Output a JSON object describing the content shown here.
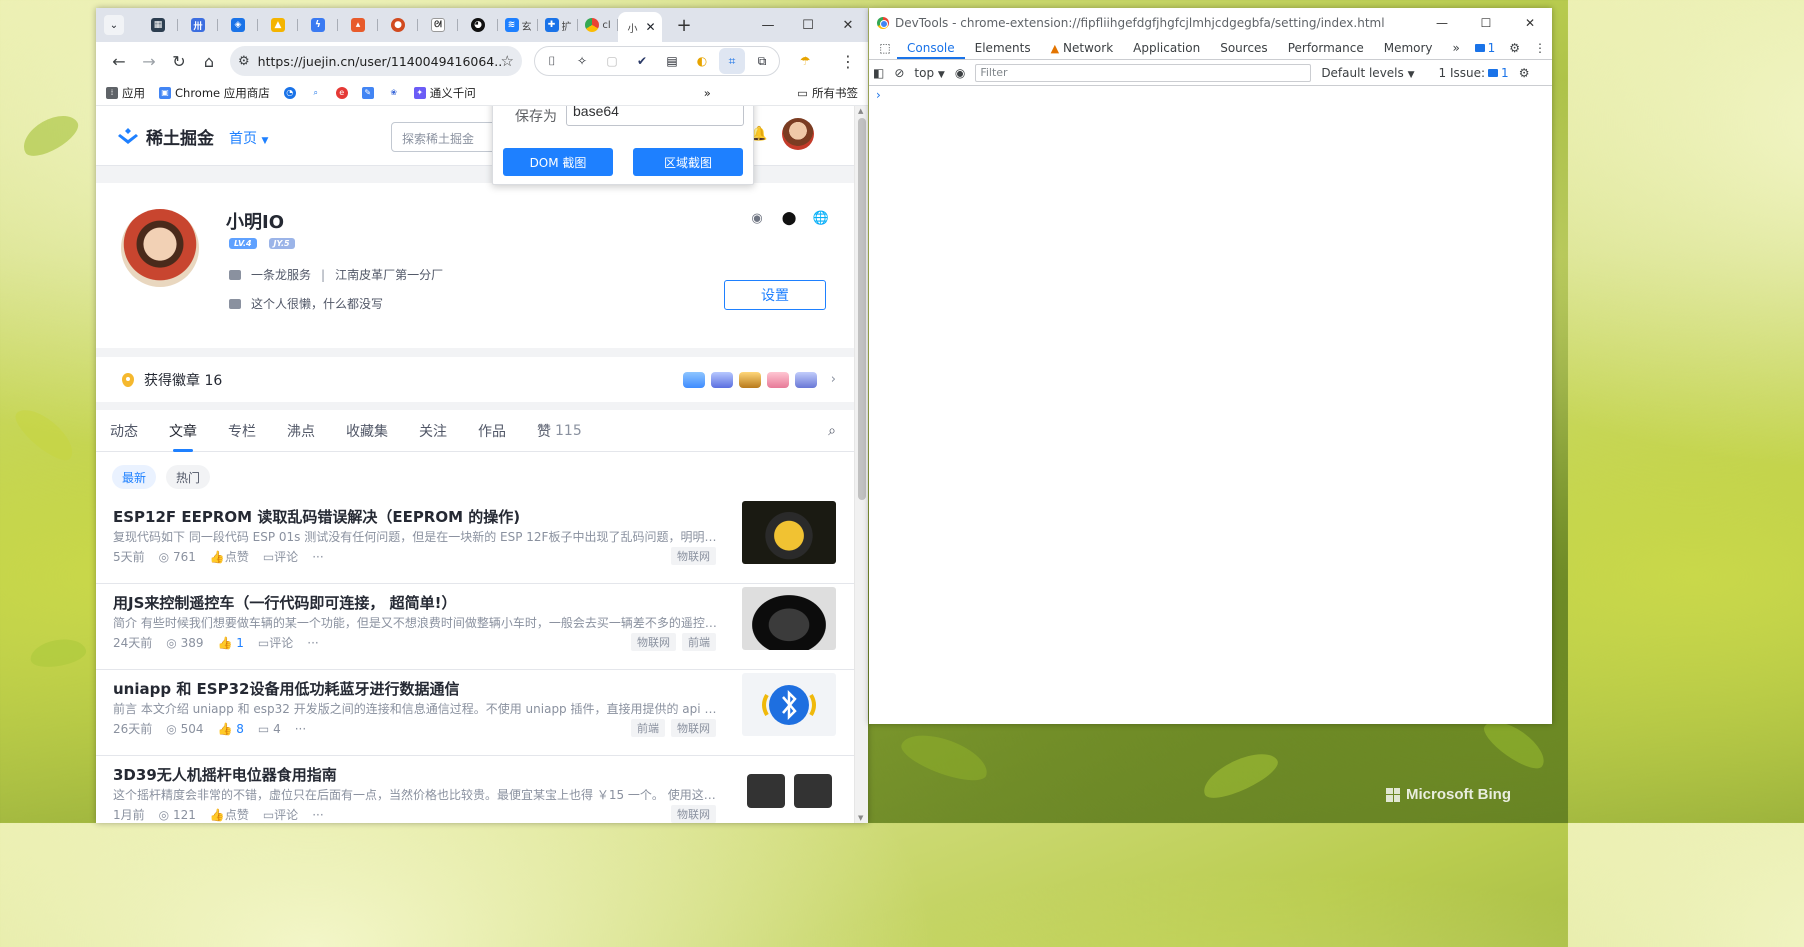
{
  "browser": {
    "tabs": [
      {
        "icon": "menu"
      },
      {
        "icon": "app-dark",
        "color": "#2c3e50"
      },
      {
        "icon": "grid-app",
        "color": "#3c6ee0"
      },
      {
        "icon": "shield-app",
        "color": "#1a73e8"
      },
      {
        "icon": "drive-app",
        "color": "#f4b400"
      },
      {
        "icon": "bolt-app",
        "color": "#3a7af2"
      },
      {
        "icon": "triangle-app",
        "color": "#e85b2b"
      },
      {
        "icon": "emblem-app",
        "color": "#d14a1f"
      },
      {
        "icon": "swirl-app",
        "color": "#333333"
      },
      {
        "icon": "github",
        "color": "#111111"
      },
      {
        "icon": "juejin",
        "color": "#1e80ff",
        "text": "玄"
      },
      {
        "icon": "puzzle",
        "color": "#1a73e8",
        "text": "扩"
      },
      {
        "icon": "chrome",
        "color": "#4285f4",
        "text": "cl"
      },
      {
        "icon": "juejin-active",
        "color": "#1e80ff",
        "text": "小"
      }
    ],
    "url": "https://juejin.cn/user/1140049416064...",
    "bookmarks": [
      {
        "label": "应用",
        "color": "#5f6368"
      },
      {
        "label": "Chrome 应用商店",
        "color": "#4285f4"
      },
      {
        "label": "",
        "color": "#1a73e8"
      },
      {
        "label": "",
        "color": "#1a73e8"
      },
      {
        "label": "",
        "color": "#e53935"
      },
      {
        "label": "",
        "color": "#4285f4"
      },
      {
        "label": "",
        "color": "#3967d9"
      },
      {
        "label": "通义千问",
        "color": "#6b5cf6"
      }
    ],
    "bookmarks_all": "所有书签"
  },
  "juejin": {
    "logo": "稀土掘金",
    "nav": "首页",
    "search_placeholder": "探索稀土掘金",
    "profile": {
      "name": "小明IO",
      "level": "LV.4",
      "jy": "JY.5",
      "company": "一条龙服务",
      "title": "江南皮革厂第一分厂",
      "bio": "这个人很懒，什么都没写",
      "settings": "设置"
    },
    "badges": {
      "label": "获得徽章 16"
    },
    "tabs": [
      {
        "label": "动态"
      },
      {
        "label": "文章"
      },
      {
        "label": "专栏"
      },
      {
        "label": "沸点"
      },
      {
        "label": "收藏集"
      },
      {
        "label": "关注"
      },
      {
        "label": "作品"
      }
    ],
    "likes_tab": {
      "label": "赞",
      "count": "115"
    },
    "filters": {
      "latest": "最新",
      "hot": "热门"
    },
    "articles": [
      {
        "title": "ESP12F EEPROM 读取乱码错误解决（EEPROM 的操作)",
        "abstract": "复现代码如下 同一段代码 ESP 01s 测试没有任何问题，但是在一块新的 ESP 12F板子中出现了乱码问题，明明没有写入...",
        "time": "5天前",
        "views": "761",
        "likes": "点赞",
        "comments": "评论",
        "tags": [
          "物联网"
        ]
      },
      {
        "title": "用JS来控制遥控车（一行代码即可连接， 超简单!）",
        "abstract": "简介 有些时候我们想要做车辆的某一个功能，但是又不想浪费时间做整辆小车时，一般会去买一辆差不多的遥控车来改...",
        "time": "24天前",
        "views": "389",
        "likes": "1",
        "comments": "评论",
        "tags": [
          "物联网",
          "前端"
        ]
      },
      {
        "title": "uniapp 和 ESP32设备用低功耗蓝牙进行数据通信",
        "abstract": "前言 本文介绍 uniapp 和 esp32 开发版之间的连接和信息通信过程。不使用 uniapp 插件，直接用提供的 api 进行实现...",
        "time": "26天前",
        "views": "504",
        "likes": "8",
        "comments": "4",
        "tags": [
          "前端",
          "物联网"
        ]
      },
      {
        "title": "3D39无人机摇杆电位器食用指南",
        "abstract": "这个摇杆精度会非常的不错，虚位只在后面有一点，当然价格也比较贵。最便宜某宝上也得 ￥15 一个。 使用这个摇杆...",
        "time": "1月前",
        "views": "121",
        "likes": "点赞",
        "comments": "评论",
        "tags": [
          "物联网"
        ]
      }
    ]
  },
  "popup": {
    "save_as_label": "保存为",
    "save_as_value": "base64",
    "dom_button": "DOM 截图",
    "region_button": "区域截图"
  },
  "devtools": {
    "title": "DevTools - chrome-extension://fipfliihgefdgfjhgfcjlmhjcdgegbfa/setting/index.html",
    "tabs": [
      "Console",
      "Elements",
      "Network",
      "Application",
      "Sources",
      "Performance",
      "Memory"
    ],
    "messages_count": "1",
    "context": "top",
    "filter_placeholder": "Filter",
    "levels": "Default levels",
    "issues_label": "1 Issue:",
    "issues_count": "1",
    "prompt": "›"
  },
  "desktop": {
    "watermark": "Microsoft Bing"
  }
}
